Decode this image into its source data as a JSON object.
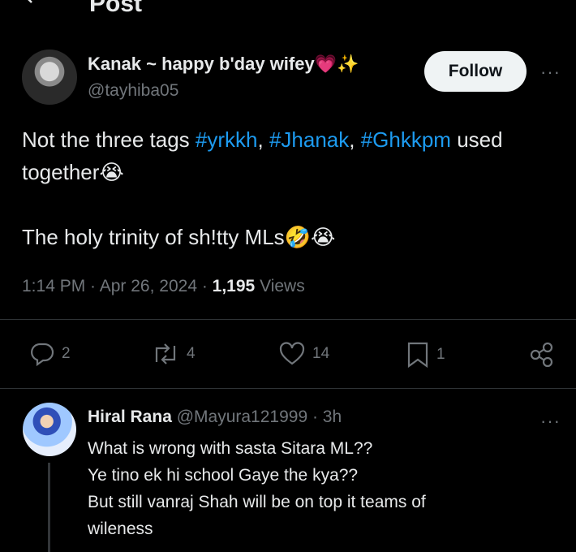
{
  "header": {
    "title": "Post"
  },
  "tweet": {
    "author_name": "Kanak ~ happy b'day wifey💗✨",
    "author_handle": "@tayhiba05",
    "follow_label": "Follow",
    "more_label": "···",
    "line1_prefix": "Not the three tags ",
    "tag1": "#yrkkh",
    "sep1": ", ",
    "tag2": "#Jhanak",
    "sep2": ", ",
    "tag3": "#Ghkkpm",
    "line1_suffix": " used",
    "line2": "together😭",
    "line3": "The holy trinity of sh!tty MLs🤣😭",
    "time": "1:14 PM",
    "dot1": " · ",
    "date": "Apr 26, 2024",
    "dot2": " · ",
    "views_count": "1,195",
    "views_label": " Views",
    "replies": "2",
    "reposts": "4",
    "likes": "14",
    "bookmarks": "1"
  },
  "reply": {
    "author_name": "Hiral Rana",
    "author_handle": "@Mayura121999",
    "age": " · 3h",
    "more_label": "···",
    "lines": [
      "What is wrong with sasta Sitara ML??",
      "Ye tino ek hi school Gaye the kya??",
      "But still vanraj Shah will be on top it teams of",
      "wileness"
    ]
  },
  "colors": {
    "background": "#000000",
    "link": "#1d9bf0",
    "muted": "#71767b",
    "text": "#e7e9ea"
  }
}
